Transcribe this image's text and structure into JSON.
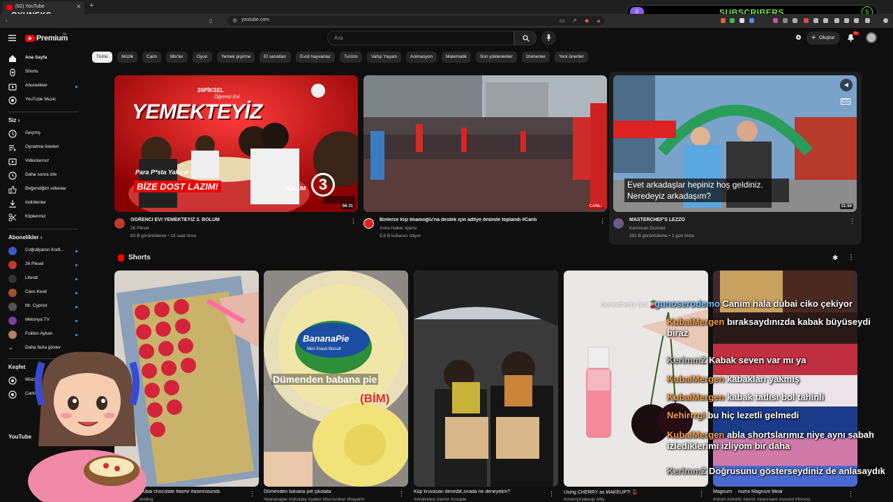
{
  "browser": {
    "tab_title": "(62) YouTube",
    "url": "youtube.com",
    "overlay_logo": "OYUNEKS",
    "subscribers_label": "SUBSCRIBERS",
    "subscribers_count_left": "0",
    "subscribers_count_right": "5"
  },
  "header": {
    "brand": "Premium",
    "brand_sup": "TR",
    "search_placeholder": "Ara",
    "create_label": "Oluştur",
    "notif_badge": "9+"
  },
  "chips": [
    "Tümü",
    "Müzik",
    "Canlı",
    "Mix'ler",
    "Oyun",
    "Yemek pişirme",
    "El sanatları",
    "Evcil hayvanlar",
    "Turizm",
    "Vahşi Yaşam",
    "Animasyon",
    "Matematik",
    "Son yüklenenler",
    "İzlenenler",
    "Yeni öneriler"
  ],
  "sidebar": {
    "main": [
      {
        "label": "Ana Sayfa",
        "icon": "home-icon"
      },
      {
        "label": "Shorts",
        "icon": "shorts-icon"
      },
      {
        "label": "Abonelikler",
        "icon": "subscriptions-icon"
      },
      {
        "label": "YouTube Music",
        "icon": "music-icon"
      }
    ],
    "you_title": "Siz",
    "you": [
      {
        "label": "Geçmiş",
        "icon": "history-icon"
      },
      {
        "label": "Oynatma listeleri",
        "icon": "playlists-icon"
      },
      {
        "label": "Videolarınız",
        "icon": "your-videos-icon"
      },
      {
        "label": "Daha sonra izle",
        "icon": "watch-later-icon"
      },
      {
        "label": "Beğendiğim videolar",
        "icon": "liked-icon"
      },
      {
        "label": "İndirilenler",
        "icon": "downloads-icon"
      },
      {
        "label": "Kliplerimiz",
        "icon": "clips-icon"
      }
    ],
    "subs_title": "Abonelikler",
    "subs": [
      {
        "label": "Coğrafyanın Kodl...",
        "color": "#3b5bc4"
      },
      {
        "label": "26 Piksel",
        "color": "#c0392b"
      },
      {
        "label": "Literat",
        "color": "#333333"
      },
      {
        "label": "Cavs Kesit",
        "color": "#a0522d"
      },
      {
        "label": "Mr. Cypriot",
        "color": "#555555"
      },
      {
        "label": "Metonya TV",
        "color": "#7b3fa0"
      },
      {
        "label": "Fulden Aykan",
        "color": "#b08060"
      }
    ],
    "more_label": "Daha fazla göster",
    "explore_title": "Keşfet",
    "explore": [
      "Müzik",
      "Canlı"
    ],
    "yt_title": "YouTube"
  },
  "videos": [
    {
      "title": "ÖĞRENCİ EVİ YEMEKTEYİZ 3. BÖLÜM",
      "channel": "26 Piksel",
      "meta": "83 B görüntüleme • 19 saat önce",
      "duration": "56:31",
      "thumb_title": "YEMEKTEYİZ",
      "thumb_sub": "BİZE DOST LAZIM!",
      "thumb_tag": "Para P*sta Yakışır",
      "thumb_badge": "BÖLÜM",
      "thumb_num": "3",
      "thumb_brand": "26PİKSEL",
      "thumb_top": "Öğrenci Evi"
    },
    {
      "title": "Binlerce kişi İmamoğlu'na destek için adliye önünde toplandı #Canlı",
      "channel": "Anka Haber Ajansı",
      "meta": "5,6 B kullanıcı izliyor",
      "live": "CANLI"
    },
    {
      "title": "MASTERCHEF'S LEZZO",
      "channel": "Kerimcan Durmaz",
      "meta": "391 B görüntüleme • 1 gün önce",
      "duration": "31:50",
      "caption": "Evet arkadaşlar hepiniz hoş geldiniz. Neredeyiz arkadaşım?"
    }
  ],
  "shorts": {
    "title": "Shorts",
    "items": [
      {
        "title": "Dubai chocolate #asmr #asmrsounds",
        "sub": "ending"
      },
      {
        "title": "Dümenden banana pie çikolata",
        "sub": "#bananapie #çikolata #şeker #bursunbur #hayarm",
        "overlay": "Dümenden babana pie",
        "overlay2": "(BİM)",
        "pack": "BananaPie",
        "pack_sub": "Mini Snack Biscuit"
      },
      {
        "title": "Küp kruvasan denedik,sırada ne deneyelim?",
        "sub": "#viralvideo #asmr #couple"
      },
      {
        "title": "Using CHERRY as MAKEUP?! 🍒",
        "sub": "#cherrymakeup #diy",
        "overlay": "benecherry tint 🍒"
      },
      {
        "title": "Magnum",
        "sub": "#short #shorts #asmr #icecream #sound #forvou",
        "right_tail": "nums Magnum Meal"
      }
    ]
  },
  "chat": [
    {
      "user": "gunoserodemo",
      "msg": "Canım hala dubai ciko çekiyor",
      "ucls": "b"
    },
    {
      "user": "KubaiMergen",
      "msg": "bıraksaydınızda kabak büyüseydi biraz",
      "ucls": ""
    },
    {
      "user": "KerimmZ",
      "msg": "Kabak seven var mı ya",
      "ucls": "g"
    },
    {
      "user": "KubaiMergen",
      "msg": "kabakları yakmış",
      "ucls": ""
    },
    {
      "user": "KubaiMergen",
      "msg": "kabak tatlısı bol tahinli",
      "ucls": ""
    },
    {
      "user": "Nehirrrgi",
      "msg": "bu hiç lezetli gelmedi",
      "ucls": ""
    },
    {
      "user": "KubaiMergen",
      "msg": "abla shortslarımız niye aynı sabah izlediklerimi izliyom bir daha",
      "ucls": ""
    },
    {
      "user": "KerimmZ",
      "msg": "Doğrusunu gösterseydiniz de anlasaydık",
      "ucls": "g"
    }
  ]
}
